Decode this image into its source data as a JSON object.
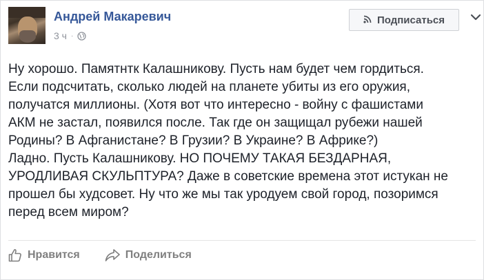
{
  "post": {
    "author": "Андрей Макаревич",
    "time": "3 ч",
    "separator": "·",
    "subscribe_label": "Подписаться",
    "lines": [
      "Ну хорошо. Памятнтк Калашникову. Пусть нам будет чем гордиться.",
      "Если подсчитать, сколько людей на планете убиты из его оружия,",
      "получатся миллионы. (Хотя вот что интересно - войну с фашистами",
      "АКМ не застал, появился после. Так где он защищал рубежи нашей",
      "Родины? В Афганистане? В Грузии? В Украине? В Африке?)",
      "Ладно. Пусть Калашникову. НО ПОЧЕМУ ТАКАЯ БЕЗДАРНАЯ,",
      "УРОДЛИВАЯ СКУЛЬПТУРА? Даже в советские времена этот истукан не",
      "прошел бы худсовет. Ну что же мы так уродуем свой город, позоримся",
      "перед всем миром?"
    ]
  },
  "actions": {
    "like_label": "Нравится",
    "share_label": "Поделиться"
  },
  "icons": {
    "avatar": "author-avatar",
    "globe": "globe-icon",
    "rss": "rss-icon",
    "chevron": "chevron-down-icon",
    "like": "thumbs-up-icon",
    "share": "share-arrow-icon"
  },
  "colors": {
    "author_link": "#365899",
    "meta_text": "#90949c",
    "body_text": "#1d2129",
    "action_text": "#7f7f7f"
  }
}
